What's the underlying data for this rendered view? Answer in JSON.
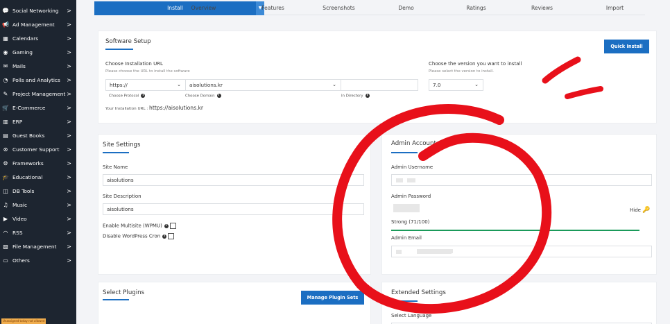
{
  "sidebar": {
    "items": [
      {
        "label": "Social Networking",
        "icon": "chat-icon",
        "glyph": "💬"
      },
      {
        "label": "Ad Management",
        "icon": "megaphone-icon",
        "glyph": "📢"
      },
      {
        "label": "Calendars",
        "icon": "calendar-icon",
        "glyph": "▦"
      },
      {
        "label": "Gaming",
        "icon": "gamepad-icon",
        "glyph": "◉"
      },
      {
        "label": "Mails",
        "icon": "envelope-icon",
        "glyph": "✉"
      },
      {
        "label": "Polls and Analytics",
        "icon": "pie-chart-icon",
        "glyph": "◔"
      },
      {
        "label": "Project Management",
        "icon": "edit-icon",
        "glyph": "✎"
      },
      {
        "label": "E-Commerce",
        "icon": "cart-icon",
        "glyph": "🛒"
      },
      {
        "label": "ERP",
        "icon": "bar-chart-icon",
        "glyph": "▥"
      },
      {
        "label": "Guest Books",
        "icon": "book-icon",
        "glyph": "▤"
      },
      {
        "label": "Customer Support",
        "icon": "lifebuoy-icon",
        "glyph": "⊛"
      },
      {
        "label": "Frameworks",
        "icon": "cogs-icon",
        "glyph": "⚙"
      },
      {
        "label": "Educational",
        "icon": "graduation-cap-icon",
        "glyph": "🎓"
      },
      {
        "label": "DB Tools",
        "icon": "database-icon",
        "glyph": "◫"
      },
      {
        "label": "Music",
        "icon": "music-icon",
        "glyph": "♫"
      },
      {
        "label": "Video",
        "icon": "video-icon",
        "glyph": "▶"
      },
      {
        "label": "RSS",
        "icon": "rss-icon",
        "glyph": "◠"
      },
      {
        "label": "File Management",
        "icon": "file-icon",
        "glyph": "▧"
      },
      {
        "label": "Others",
        "icon": "folder-icon",
        "glyph": "▭"
      }
    ],
    "chevron": ">",
    "bottom_badge": "Unassigned today not allowed"
  },
  "tabs": [
    {
      "label": "Install",
      "active": true
    },
    {
      "label": "Overview"
    },
    {
      "label": "Features"
    },
    {
      "label": "Screenshots"
    },
    {
      "label": "Demo"
    },
    {
      "label": "Ratings"
    },
    {
      "label": "Reviews"
    },
    {
      "label": "Import"
    }
  ],
  "software_setup": {
    "title": "Software Setup",
    "quick_install_label": "Quick Install",
    "choose_url_label": "Choose Installation URL",
    "choose_url_help": "Please choose the URL to install the software",
    "protocol_value": "https://",
    "domain_value": "aisolutions.kr",
    "directory_value": "",
    "protocol_caption": "Choose Protocol",
    "domain_caption": "Choose Domain",
    "directory_caption": "In Directory",
    "install_url_prefix": "Your Installation URL :",
    "install_url": "https://aisolutions.kr",
    "version_label": "Choose the version you want to install",
    "version_help": "Please select the version to install.",
    "version_value": "7.0"
  },
  "site_settings": {
    "title": "Site Settings",
    "site_name_label": "Site Name",
    "site_name_value": "aisolutions",
    "site_desc_label": "Site Description",
    "site_desc_value": "aisolutions",
    "multisite_label": "Enable Multisite (WPMU)",
    "cron_label": "Disable WordPress Cron"
  },
  "admin_account": {
    "title": "Admin Account",
    "username_label": "Admin Username",
    "password_label": "Admin Password",
    "hide_label": "Hide",
    "strength_label": "Strong (71/100)",
    "email_label": "Admin Email"
  },
  "plugins": {
    "title": "Select Plugins",
    "manage_label": "Manage Plugin Sets"
  },
  "extended": {
    "title": "Extended Settings",
    "language_label": "Select Language"
  },
  "colors": {
    "accent": "#1b6ec2",
    "sidebar_bg": "#1d2530",
    "annotation": "#e8101a",
    "strength_bar": "#1a9a5a"
  }
}
